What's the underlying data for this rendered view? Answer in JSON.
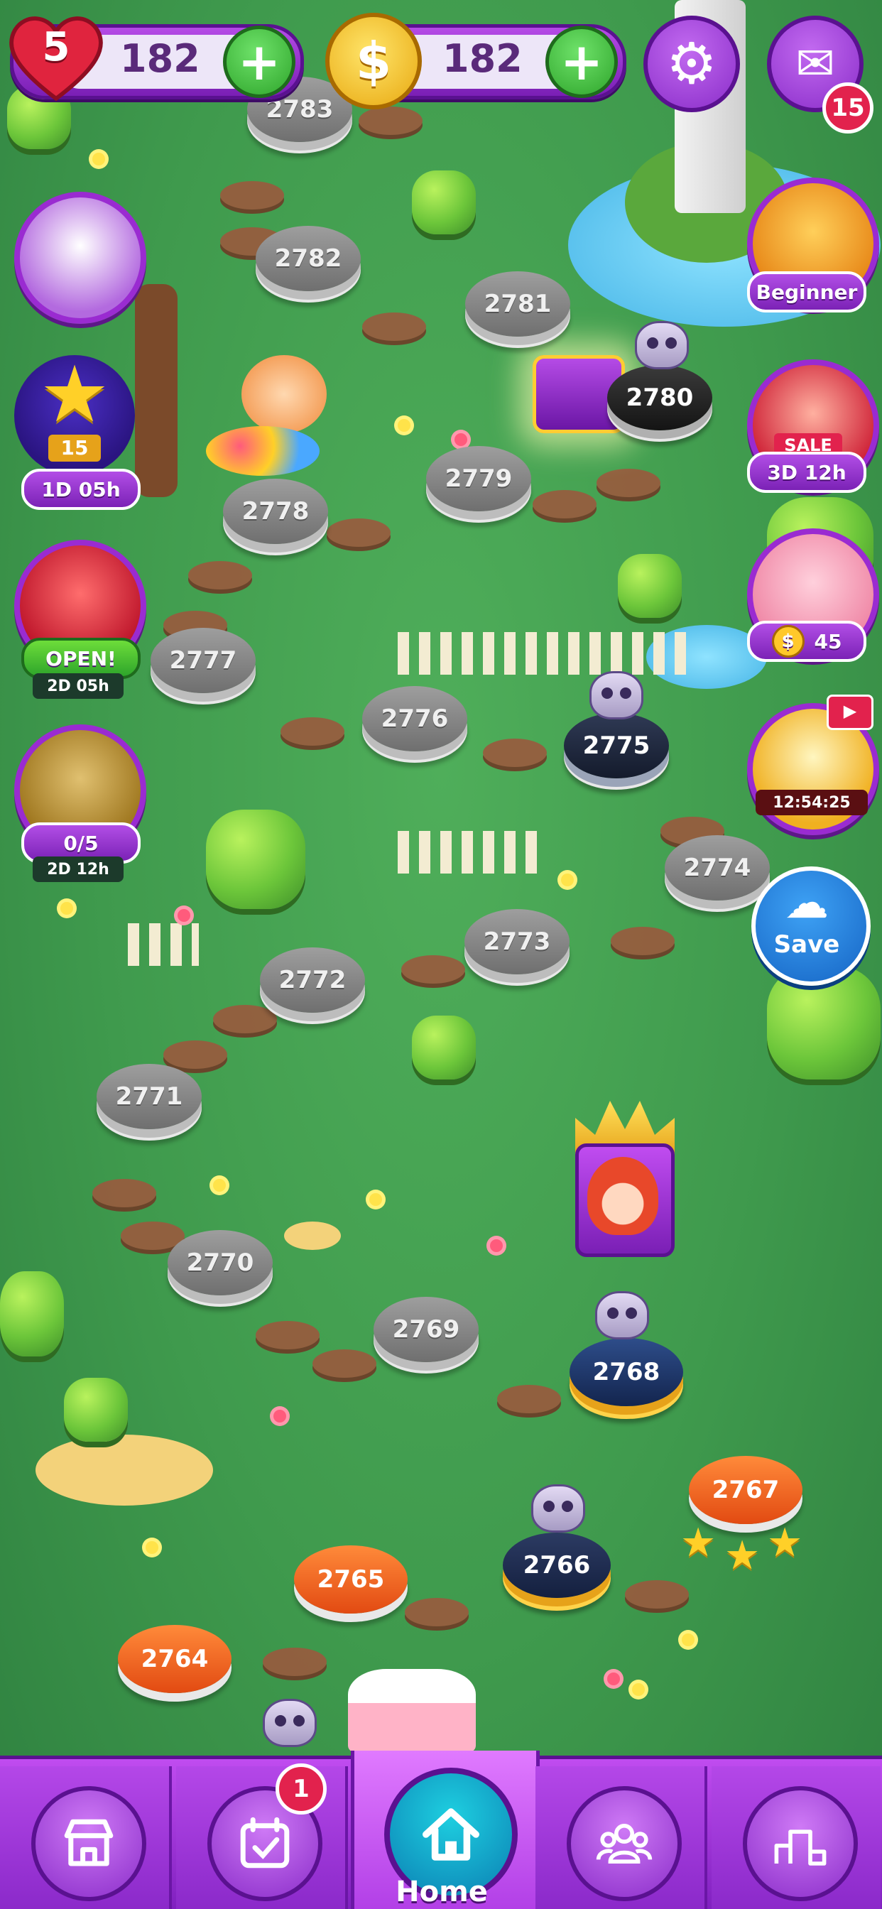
{
  "top_bar": {
    "lives": "5",
    "lives_count": "182",
    "coins": "182",
    "mail_badge": "15"
  },
  "side_left": {
    "star_event": {
      "level": "15",
      "timer": "1D 05h"
    },
    "chest": {
      "label": "OPEN!",
      "timer": "2D 05h"
    },
    "pass": {
      "progress": "0/5",
      "timer": "2D 12h"
    }
  },
  "side_right": {
    "beginner": {
      "label": "Beginner"
    },
    "sale": {
      "tag": "SALE",
      "timer": "3D 12h"
    },
    "piggy": {
      "coins": "45"
    },
    "video": {
      "timer": "12:54:25"
    },
    "save": {
      "label": "Save"
    }
  },
  "levels": [
    {
      "num": "2783",
      "state": "locked"
    },
    {
      "num": "2782",
      "state": "locked"
    },
    {
      "num": "2781",
      "state": "locked"
    },
    {
      "num": "2780",
      "state": "hard-locked"
    },
    {
      "num": "2779",
      "state": "locked"
    },
    {
      "num": "2778",
      "state": "locked"
    },
    {
      "num": "2777",
      "state": "locked"
    },
    {
      "num": "2776",
      "state": "locked"
    },
    {
      "num": "2775",
      "state": "hard-locked"
    },
    {
      "num": "2774",
      "state": "locked"
    },
    {
      "num": "2773",
      "state": "locked"
    },
    {
      "num": "2772",
      "state": "locked"
    },
    {
      "num": "2771",
      "state": "locked"
    },
    {
      "num": "2770",
      "state": "locked"
    },
    {
      "num": "2769",
      "state": "locked"
    },
    {
      "num": "2768",
      "state": "current"
    },
    {
      "num": "2767",
      "state": "completed",
      "stars": 3
    },
    {
      "num": "2766",
      "state": "hard-completed"
    },
    {
      "num": "2765",
      "state": "completed"
    },
    {
      "num": "2764",
      "state": "completed"
    }
  ],
  "nav": {
    "tabs": [
      "shop",
      "daily",
      "home",
      "team",
      "leaderboard"
    ],
    "home_label": "Home",
    "daily_badge": "1"
  },
  "colors": {
    "purple": "#8a2dc9",
    "grass": "#3f9a4d",
    "orange_level": "#e24a12",
    "gold": "#ffd028"
  }
}
